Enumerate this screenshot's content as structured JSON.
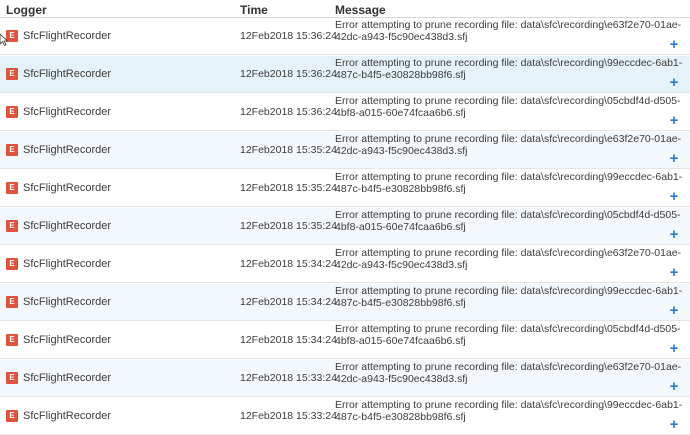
{
  "columns": {
    "logger": "Logger",
    "time": "Time",
    "message": "Message"
  },
  "level_badge": "E",
  "expand_glyph": "+",
  "colors": {
    "error_badge": "#e0533b",
    "expand": "#2b7bd0",
    "row_highlight": "#e6f2fa"
  },
  "rows": [
    {
      "logger": "SfcFlightRecorder",
      "time": "12Feb2018 15:36:24",
      "message": "Error attempting to prune recording file: data\\sfc\\recording\\e63f2e70-01ae-42dc-a943-f5c90ec438d3.sfj"
    },
    {
      "logger": "SfcFlightRecorder",
      "time": "12Feb2018 15:36:24",
      "message": "Error attempting to prune recording file: data\\sfc\\recording\\99eccdec-6ab1-487c-b4f5-e30828bb98f6.sfj"
    },
    {
      "logger": "SfcFlightRecorder",
      "time": "12Feb2018 15:36:24",
      "message": "Error attempting to prune recording file: data\\sfc\\recording\\05cbdf4d-d505-4bf8-a015-60e74fcaa6b6.sfj"
    },
    {
      "logger": "SfcFlightRecorder",
      "time": "12Feb2018 15:35:24",
      "message": "Error attempting to prune recording file: data\\sfc\\recording\\e63f2e70-01ae-42dc-a943-f5c90ec438d3.sfj"
    },
    {
      "logger": "SfcFlightRecorder",
      "time": "12Feb2018 15:35:24",
      "message": "Error attempting to prune recording file: data\\sfc\\recording\\99eccdec-6ab1-487c-b4f5-e30828bb98f6.sfj"
    },
    {
      "logger": "SfcFlightRecorder",
      "time": "12Feb2018 15:35:24",
      "message": "Error attempting to prune recording file: data\\sfc\\recording\\05cbdf4d-d505-4bf8-a015-60e74fcaa6b6.sfj"
    },
    {
      "logger": "SfcFlightRecorder",
      "time": "12Feb2018 15:34:24",
      "message": "Error attempting to prune recording file: data\\sfc\\recording\\e63f2e70-01ae-42dc-a943-f5c90ec438d3.sfj"
    },
    {
      "logger": "SfcFlightRecorder",
      "time": "12Feb2018 15:34:24",
      "message": "Error attempting to prune recording file: data\\sfc\\recording\\99eccdec-6ab1-487c-b4f5-e30828bb98f6.sfj"
    },
    {
      "logger": "SfcFlightRecorder",
      "time": "12Feb2018 15:34:24",
      "message": "Error attempting to prune recording file: data\\sfc\\recording\\05cbdf4d-d505-4bf8-a015-60e74fcaa6b6.sfj"
    },
    {
      "logger": "SfcFlightRecorder",
      "time": "12Feb2018 15:33:24",
      "message": "Error attempting to prune recording file: data\\sfc\\recording\\e63f2e70-01ae-42dc-a943-f5c90ec438d3.sfj"
    },
    {
      "logger": "SfcFlightRecorder",
      "time": "12Feb2018 15:33:24",
      "message": "Error attempting to prune recording file: data\\sfc\\recording\\99eccdec-6ab1-487c-b4f5-e30828bb98f6.sfj"
    }
  ]
}
